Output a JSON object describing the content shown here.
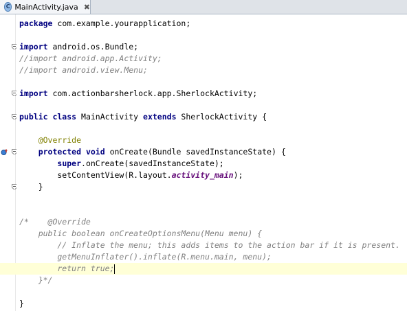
{
  "tab": {
    "title": "MainActivity.java",
    "icon": "class-file-icon",
    "close": "✖"
  },
  "editor": {
    "lines": [
      [
        {
          "t": "package",
          "c": "kw"
        },
        {
          "t": " com.example.yourapplication;"
        }
      ],
      [],
      [
        {
          "t": "import",
          "c": "kw"
        },
        {
          "t": " android.os.Bundle;"
        }
      ],
      [
        {
          "t": "//import android.app.Activity;",
          "c": "cm"
        }
      ],
      [
        {
          "t": "//import android.view.Menu;",
          "c": "cm"
        }
      ],
      [],
      [
        {
          "t": "import",
          "c": "kw"
        },
        {
          "t": " com.actionbarsherlock.app.SherlockActivity;"
        }
      ],
      [],
      [
        {
          "t": "public class",
          "c": "kw"
        },
        {
          "t": " MainActivity "
        },
        {
          "t": "extends",
          "c": "kw"
        },
        {
          "t": " SherlockActivity {"
        }
      ],
      [],
      [
        {
          "t": "    "
        },
        {
          "t": "@Override",
          "c": "ann"
        }
      ],
      [
        {
          "t": "    "
        },
        {
          "t": "protected void",
          "c": "kw"
        },
        {
          "t": " onCreate(Bundle savedInstanceState) {"
        }
      ],
      [
        {
          "t": "        "
        },
        {
          "t": "super",
          "c": "kw"
        },
        {
          "t": ".onCreate(savedInstanceState);"
        }
      ],
      [
        {
          "t": "        setContentView(R.layout."
        },
        {
          "t": "activity_main",
          "c": "fld"
        },
        {
          "t": ");"
        }
      ],
      [
        {
          "t": "    }"
        }
      ],
      [],
      [],
      [
        {
          "t": "/*    @Override",
          "c": "cm"
        }
      ],
      [
        {
          "t": "    public boolean onCreateOptionsMenu(Menu menu) {",
          "c": "cm"
        }
      ],
      [
        {
          "t": "        // Inflate the menu; this adds items to the action bar if it is present.",
          "c": "cm"
        }
      ],
      [
        {
          "t": "        getMenuInflater().inflate(R.menu.main, menu);",
          "c": "cm"
        }
      ],
      [
        {
          "t": "        return true;",
          "c": "cm"
        }
      ],
      [
        {
          "t": "    }*/",
          "c": "cm"
        }
      ],
      [],
      [
        {
          "t": "}"
        }
      ]
    ],
    "current_line": 21,
    "fold_markers": [
      2,
      6,
      8,
      11,
      14
    ],
    "impl_marker_line": 11,
    "colors": {
      "keyword": "#000080",
      "comment": "#808080",
      "annotation": "#808000",
      "field": "#660e7a",
      "current_line": "#ffffd7"
    }
  }
}
